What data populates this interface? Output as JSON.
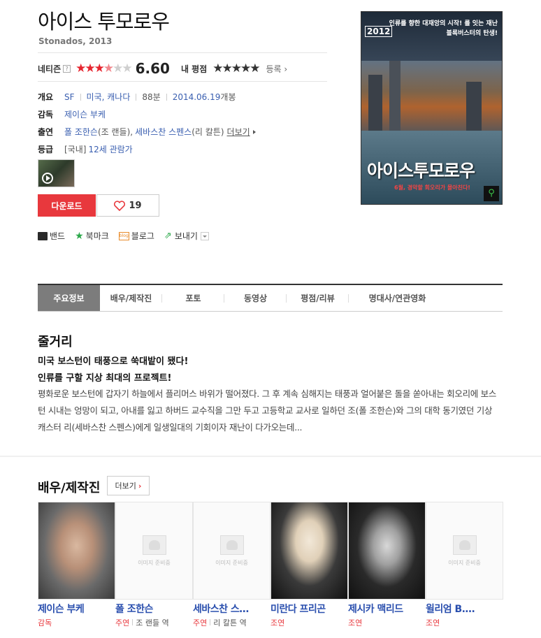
{
  "movie": {
    "title": "아이스 투모로우",
    "subtitle": "Stonados, 2013"
  },
  "rating": {
    "netizen_label": "네티즌",
    "help": "?",
    "stars_on": "★★★",
    "stars_half": "★",
    "stars_off": "★★",
    "score": "6.60",
    "my_label": "내 평점",
    "my_stars": "★★★★★",
    "register": "등록 ›"
  },
  "info": {
    "summary_label": "개요",
    "genre": "SF",
    "country": "미국, 캐나다",
    "runtime": "88분",
    "release": "2014.06.19",
    "release_suffix": "개봉",
    "director_label": "감독",
    "director": "제이슨 부케",
    "cast_label": "출연",
    "cast1": "폴 조한슨",
    "cast1_role": "(조 랜들),",
    "cast2": "세바스찬 스펜스",
    "cast2_role": "(리 칼튼)",
    "cast_more": "더보기",
    "grade_label": "등급",
    "grade_region": "[국내]",
    "grade": "12세 관람가"
  },
  "actions": {
    "download": "다운로드",
    "likes": "19"
  },
  "share": {
    "band": "밴드",
    "bookmark": "북마크",
    "blog_icon_text": "blog",
    "blog": "블로그",
    "send": "보내기"
  },
  "poster": {
    "tagline": "인류를 향한 대재앙의 시작! 를 잇는 재난 블록버스터의 탄생!",
    "year_tag": "2012",
    "title": "아이스투모로우",
    "sub": "6월, 경악할 회오리가 몰아친다!"
  },
  "tabs": [
    "주요정보",
    "배우/제작진",
    "포토",
    "동영상",
    "평점/리뷰",
    "명대사/연관영화"
  ],
  "synopsis": {
    "heading": "줄거리",
    "line1": "미국 보스턴이 태풍으로 쑥대밭이 됐다!",
    "line2": "인류를 구할 지상 최대의 프로젝트!",
    "body": "평화로운 보스턴에 갑자기 하늘에서 플리머스 바위가 떨어졌다. 그 후 계속 심해지는 태풍과 얼어붙은 돌을 쏟아내는 회오리에 보스턴 시내는 엉망이 되고, 아내를 잃고 하버드 교수직을 그만 두고 고등학교 교사로 일하던 조(폴 조한슨)와 그의 대학 동기였던 기상 캐스터 리(세바스찬 스펜스)에게 일생일대의 기회이자 재난이 다가오는데..."
  },
  "cast_section": {
    "heading": "배우/제작진",
    "more": "더보기",
    "placeholder": "이미지 준비중",
    "people": [
      {
        "name": "제이슨 부케",
        "role": "감독",
        "character": ""
      },
      {
        "name": "폴 조한슨",
        "role": "주연",
        "character": "조 랜들 역"
      },
      {
        "name": "세바스찬 스…",
        "role": "주연",
        "character": "리 칼튼 역"
      },
      {
        "name": "미란다 프리곤",
        "role": "조연",
        "character": ""
      },
      {
        "name": "제시카 맥리드",
        "role": "조연",
        "character": ""
      },
      {
        "name": "윌리엄 B.…",
        "role": "조연",
        "character": ""
      }
    ]
  }
}
